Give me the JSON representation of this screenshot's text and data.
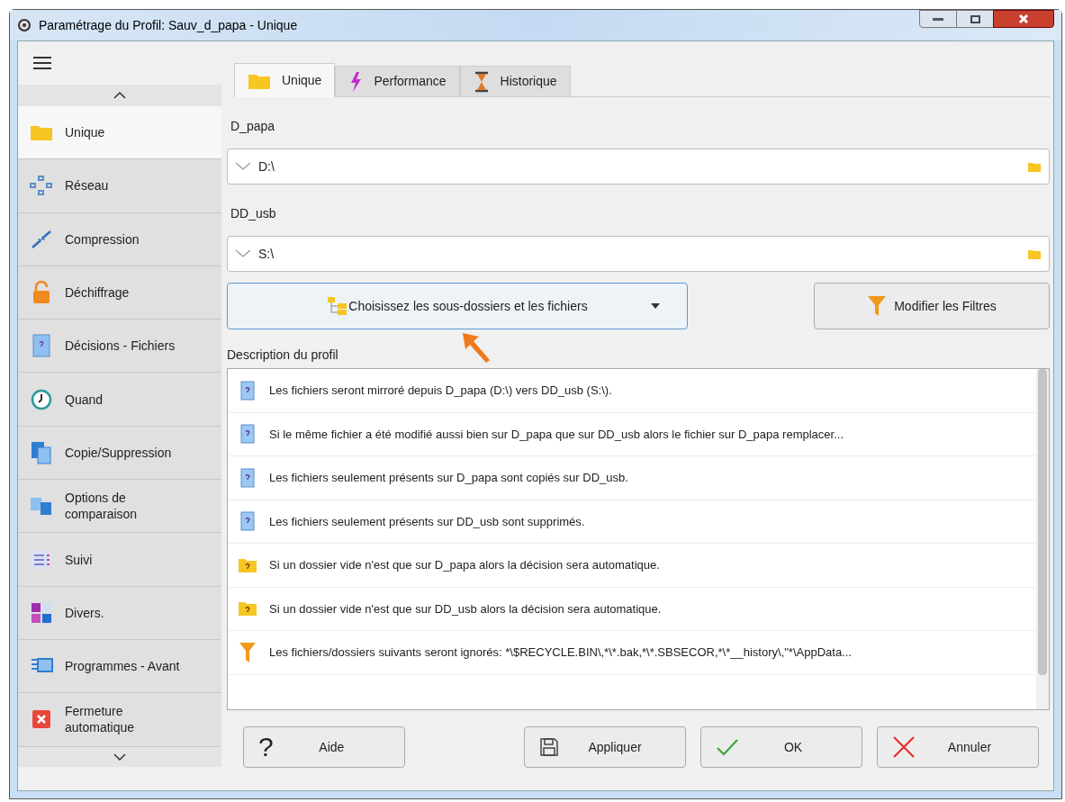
{
  "window": {
    "title": "Paramétrage du Profil: Sauv_d_papa - Unique"
  },
  "sidebar": {
    "items": [
      {
        "label": "Unique",
        "selected": true
      },
      {
        "label": "Réseau",
        "selected": false
      },
      {
        "label": "Compression",
        "selected": false
      },
      {
        "label": "Déchiffrage",
        "selected": false
      },
      {
        "label": "Décisions - Fichiers",
        "selected": false
      },
      {
        "label": "Quand",
        "selected": false
      },
      {
        "label": "Copie/Suppression",
        "selected": false
      },
      {
        "label": "Options de comparaison",
        "selected": false
      },
      {
        "label": "Suivi",
        "selected": false
      },
      {
        "label": "Divers.",
        "selected": false
      },
      {
        "label": "Programmes - Avant",
        "selected": false
      },
      {
        "label": "Fermeture automatique",
        "selected": false
      }
    ]
  },
  "tabs": [
    {
      "label": "Unique",
      "selected": true
    },
    {
      "label": "Performance",
      "selected": false
    },
    {
      "label": "Historique",
      "selected": false
    }
  ],
  "locations": [
    {
      "label": "D_papa",
      "value": "D:\\"
    },
    {
      "label": "DD_usb",
      "value": "S:\\"
    }
  ],
  "choose_button": {
    "label": "Choisissez les sous-dossiers et les fichiers"
  },
  "filters_button": {
    "label": "Modifier les Filtres"
  },
  "description": {
    "label": "Description du profil",
    "rows": [
      {
        "kind": "file",
        "text": "Les fichiers seront mirroré depuis D_papa (D:\\) vers DD_usb (S:\\)."
      },
      {
        "kind": "file",
        "text": "Si le même fichier a été modifié aussi bien sur D_papa que sur DD_usb alors le fichier sur D_papa remplacer..."
      },
      {
        "kind": "file",
        "text": "Les fichiers seulement présents sur D_papa sont copiés sur DD_usb."
      },
      {
        "kind": "file",
        "text": "Les fichiers seulement présents sur DD_usb sont supprimés."
      },
      {
        "kind": "folder",
        "text": "Si un dossier vide n'est que sur D_papa alors la décision sera automatique."
      },
      {
        "kind": "folder",
        "text": "Si un dossier vide n'est que sur DD_usb alors la décision sera automatique."
      },
      {
        "kind": "filter",
        "text": "Les fichiers/dossiers suivants seront ignorés: *\\$RECYCLE.BIN\\,*\\*.bak,*\\*.SBSECOR,*\\*__history\\,\"*\\AppData..."
      }
    ]
  },
  "buttons": [
    {
      "kind": "help",
      "icon": "?",
      "label": "Aide"
    },
    {
      "kind": "apply",
      "label": "Appliquer"
    },
    {
      "kind": "ok",
      "label": "OK"
    },
    {
      "kind": "cancel",
      "label": "Annuler"
    }
  ]
}
